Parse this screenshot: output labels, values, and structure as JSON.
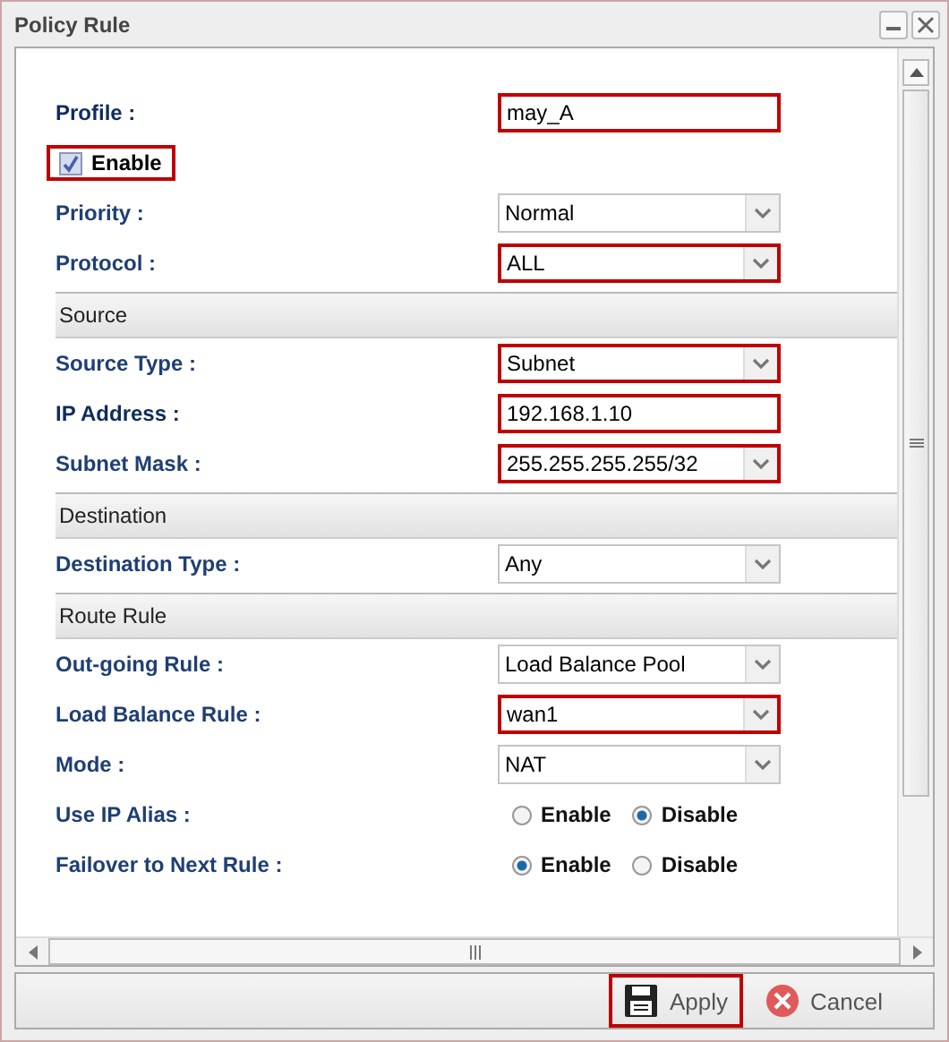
{
  "window": {
    "title": "Policy Rule"
  },
  "form": [
    {
      "kind": "text",
      "label": "Profile :",
      "value": "may_A",
      "highlighted": true
    },
    {
      "kind": "checkbox",
      "label": "Enable",
      "checked": true,
      "highlighted": true
    },
    {
      "kind": "select",
      "label": "Priority :",
      "value": "Normal",
      "highlighted": false
    },
    {
      "kind": "select",
      "label": "Protocol :",
      "value": "ALL",
      "highlighted": true
    },
    {
      "kind": "section",
      "label": "Source"
    },
    {
      "kind": "select",
      "label": "Source Type :",
      "value": "Subnet",
      "highlighted": true
    },
    {
      "kind": "text",
      "label": "IP Address :",
      "value": "192.168.1.10",
      "highlighted": true
    },
    {
      "kind": "select",
      "label": "Subnet Mask :",
      "value": "255.255.255.255/32",
      "highlighted": true
    },
    {
      "kind": "section",
      "label": "Destination"
    },
    {
      "kind": "select",
      "label": "Destination Type :",
      "value": "Any",
      "highlighted": false
    },
    {
      "kind": "section",
      "label": "Route Rule"
    },
    {
      "kind": "select",
      "label": "Out-going Rule :",
      "value": "Load Balance Pool",
      "highlighted": false
    },
    {
      "kind": "select",
      "label": "Load Balance Rule :",
      "value": "wan1",
      "highlighted": true
    },
    {
      "kind": "select",
      "label": "Mode :",
      "value": "NAT",
      "highlighted": false
    },
    {
      "kind": "radio",
      "label": "Use IP Alias :",
      "options": [
        {
          "label": "Enable",
          "selected": false
        },
        {
          "label": "Disable",
          "selected": true
        }
      ]
    },
    {
      "kind": "radio",
      "label": "Failover to Next Rule :",
      "options": [
        {
          "label": "Enable",
          "selected": true
        },
        {
          "label": "Disable",
          "selected": false
        }
      ]
    }
  ],
  "buttons": [
    {
      "kind": "apply",
      "label": "Apply",
      "highlighted": true
    },
    {
      "kind": "cancel",
      "label": "Cancel",
      "highlighted": false
    }
  ]
}
